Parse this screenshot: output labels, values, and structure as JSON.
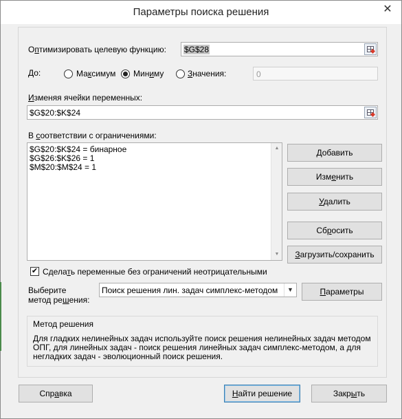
{
  "window": {
    "title": "Параметры поиска решения",
    "close_glyph": "✕"
  },
  "objective": {
    "label_pre": "О",
    "label_u": "п",
    "label_post": "тимизировать целевую функцию:",
    "value": "$G$28"
  },
  "target": {
    "label_pre": "До:",
    "options": [
      {
        "pre": "Ма",
        "u": "к",
        "post": "симум",
        "checked": false
      },
      {
        "pre": "Мин",
        "u": "и",
        "post": "му",
        "checked": true
      },
      {
        "pre": "",
        "u": "З",
        "post": "начения:",
        "checked": false
      }
    ],
    "value": "0"
  },
  "variables": {
    "label_pre": "",
    "label_u": "И",
    "label_post": "зменяя ячейки переменных:",
    "value": "$G$20:$K$24"
  },
  "constraints": {
    "label_pre": "В ",
    "label_u": "с",
    "label_post": "оответствии с ограничениями:",
    "items": [
      "$G$20:$K$24 = бинарное",
      "$G$26:$K$26 = 1",
      "$M$20:$M$24 = 1"
    ]
  },
  "buttons": {
    "add": {
      "pre": "",
      "u": "Д",
      "post": "обавить"
    },
    "change": {
      "pre": "Изм",
      "u": "е",
      "post": "нить"
    },
    "delete": {
      "pre": "",
      "u": "У",
      "post": "далить"
    },
    "reset": {
      "pre": "Сб",
      "u": "р",
      "post": "осить"
    },
    "load_save": {
      "pre": "",
      "u": "З",
      "post": "агрузить/сохранить"
    },
    "params": {
      "pre": "",
      "u": "П",
      "post": "араметры"
    },
    "help": {
      "pre": "Спр",
      "u": "а",
      "post": "вка"
    },
    "solve": {
      "pre": "",
      "u": "Н",
      "post": "айти решение"
    },
    "close": {
      "pre": "Закр",
      "u": "ы",
      "post": "ть"
    }
  },
  "nonneg": {
    "checked": true,
    "check_glyph": "✔",
    "label_pre": "Сдела",
    "label_u": "т",
    "label_post": "ь переменные без ограничений неотрицательными"
  },
  "method": {
    "label_line1": "Выберите",
    "label_line2_pre": "метод ре",
    "label_line2_u": "ш",
    "label_line2_post": "ения:",
    "selected": "Поиск решения лин. задач симплекс-методом",
    "arrow_glyph": "▼"
  },
  "method_info": {
    "title": "Метод решения",
    "text": "Для гладких нелинейных задач используйте поиск решения нелинейных задач методом ОПГ, для линейных задач - поиск решения линейных задач симплекс-методом, а для негладких задач - эволюционный поиск решения."
  },
  "scroll": {
    "up_glyph": "▲",
    "down_glyph": "▼"
  }
}
